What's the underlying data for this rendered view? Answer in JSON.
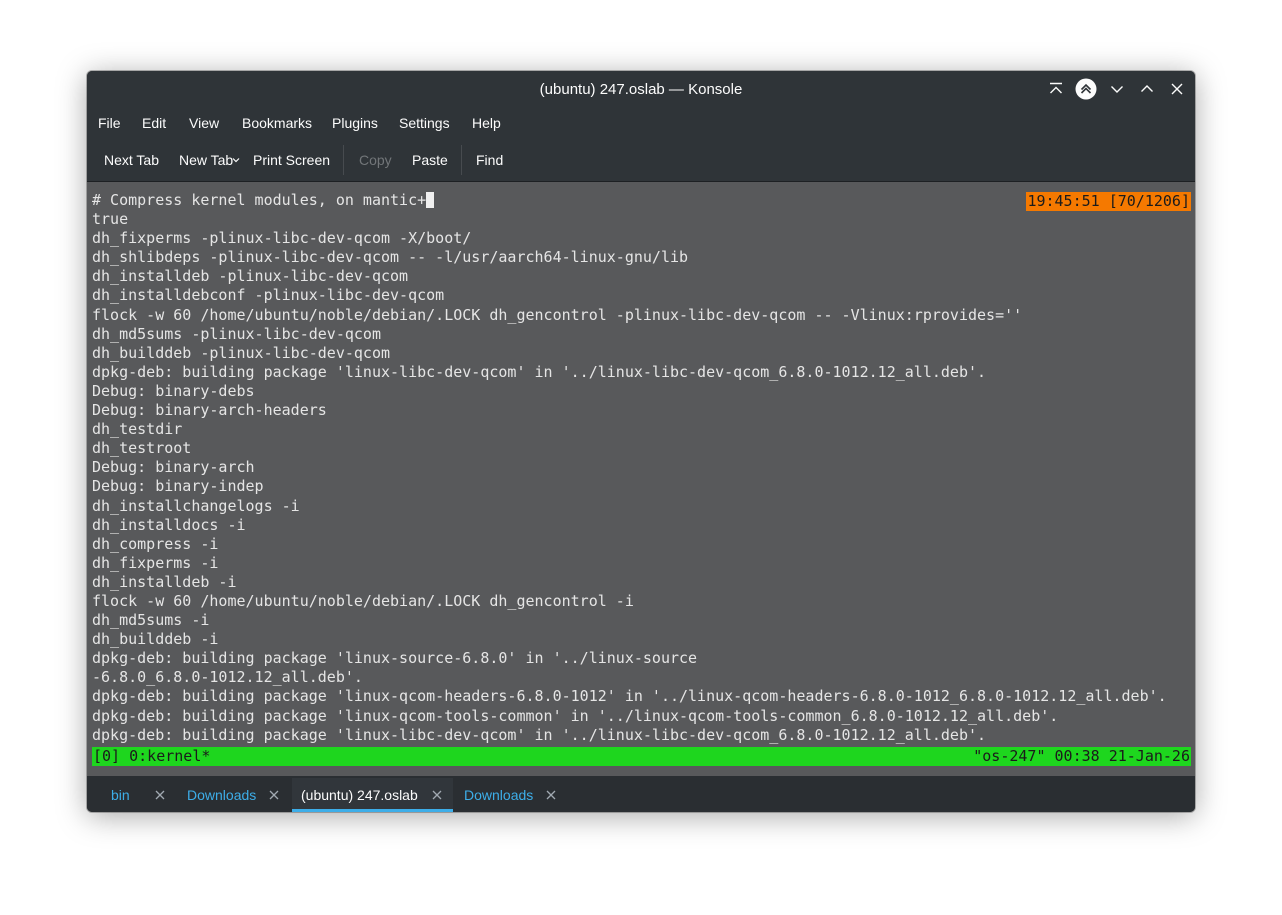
{
  "window": {
    "title": "(ubuntu) 247.oslab — Konsole"
  },
  "menubar": [
    "File",
    "Edit",
    "View",
    "Bookmarks",
    "Plugins",
    "Settings",
    "Help"
  ],
  "toolbar": {
    "next_tab": "Next Tab",
    "new_tab": "New Tab",
    "print_screen": "Print Screen",
    "copy": "Copy",
    "paste": "Paste",
    "find": "Find"
  },
  "terminal": {
    "lines": [
      "# Compress kernel modules, on mantic+",
      "true",
      "dh_fixperms -plinux-libc-dev-qcom -X/boot/",
      "dh_shlibdeps -plinux-libc-dev-qcom -- -l/usr/aarch64-linux-gnu/lib",
      "dh_installdeb -plinux-libc-dev-qcom",
      "dh_installdebconf -plinux-libc-dev-qcom",
      "flock -w 60 /home/ubuntu/noble/debian/.LOCK dh_gencontrol -plinux-libc-dev-qcom -- -Vlinux:rprovides=''",
      "dh_md5sums -plinux-libc-dev-qcom",
      "dh_builddeb -plinux-libc-dev-qcom",
      "dpkg-deb: building package 'linux-libc-dev-qcom' in '../linux-libc-dev-qcom_6.8.0-1012.12_all.deb'.",
      "Debug: binary-debs",
      "Debug: binary-arch-headers",
      "dh_testdir",
      "dh_testroot",
      "Debug: binary-arch",
      "Debug: binary-indep",
      "dh_installchangelogs -i",
      "dh_installdocs -i",
      "dh_compress -i",
      "dh_fixperms -i",
      "dh_installdeb -i",
      "flock -w 60 /home/ubuntu/noble/debian/.LOCK dh_gencontrol -i",
      "dh_md5sums -i",
      "dh_builddeb -i",
      "dpkg-deb: building package 'linux-source-6.8.0' in '../linux-source",
      "-6.8.0_6.8.0-1012.12_all.deb'.",
      "dpkg-deb: building package 'linux-qcom-headers-6.8.0-1012' in '../linux-qcom-headers-6.8.0-1012_6.8.0-1012.12_all.deb'.",
      "dpkg-deb: building package 'linux-qcom-tools-common' in '../linux-qcom-tools-common_6.8.0-1012.12_all.deb'.",
      "dpkg-deb: building package 'linux-libc-dev-qcom' in '../linux-libc-dev-qcom_6.8.0-1012.12_all.deb'."
    ],
    "clock": "19:45:51 [70/1206]",
    "status_left": "[0] 0:kernel*",
    "status_right": "\"os-247\" 00:38 21-Jan-26"
  },
  "tabs": [
    {
      "label": "bin",
      "active": false
    },
    {
      "label": "Downloads",
      "active": false
    },
    {
      "label": "(ubuntu) 247.oslab",
      "active": true
    },
    {
      "label": "Downloads",
      "active": false
    }
  ],
  "colors": {
    "accent": "#3daee9",
    "status_bar": "#1ed61e",
    "clock_badge": "#f57900",
    "terminal_bg": "#58595b"
  }
}
